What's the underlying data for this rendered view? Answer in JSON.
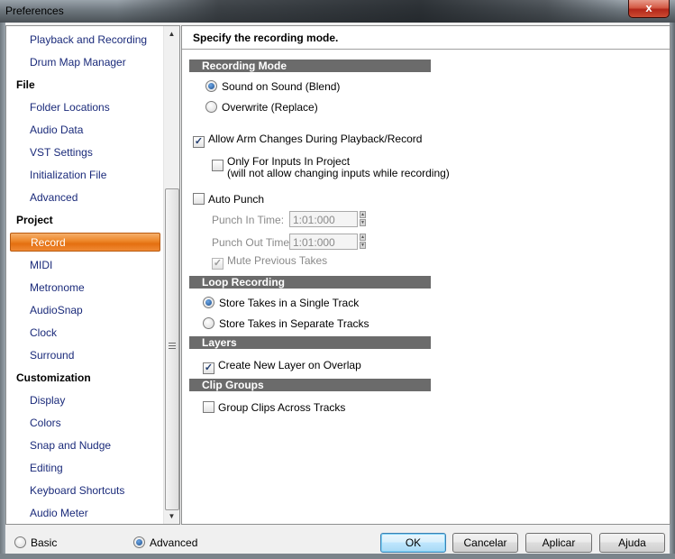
{
  "window": {
    "title": "Preferences",
    "close_label": "x"
  },
  "sidebar": {
    "items": [
      {
        "label": "Playback and Recording",
        "type": "item"
      },
      {
        "label": "Drum Map Manager",
        "type": "item"
      },
      {
        "label": "File",
        "type": "category"
      },
      {
        "label": "Folder Locations",
        "type": "item"
      },
      {
        "label": "Audio Data",
        "type": "item"
      },
      {
        "label": "VST Settings",
        "type": "item"
      },
      {
        "label": "Initialization File",
        "type": "item"
      },
      {
        "label": "Advanced",
        "type": "item"
      },
      {
        "label": "Project",
        "type": "category"
      },
      {
        "label": "Record",
        "type": "item",
        "selected": true
      },
      {
        "label": "MIDI",
        "type": "item"
      },
      {
        "label": "Metronome",
        "type": "item"
      },
      {
        "label": "AudioSnap",
        "type": "item"
      },
      {
        "label": "Clock",
        "type": "item"
      },
      {
        "label": "Surround",
        "type": "item"
      },
      {
        "label": "Customization",
        "type": "category"
      },
      {
        "label": "Display",
        "type": "item"
      },
      {
        "label": "Colors",
        "type": "item"
      },
      {
        "label": "Snap and Nudge",
        "type": "item"
      },
      {
        "label": "Editing",
        "type": "item"
      },
      {
        "label": "Keyboard Shortcuts",
        "type": "item"
      },
      {
        "label": "Audio Meter",
        "type": "item"
      }
    ],
    "scroll_up_icon": "triangle-up",
    "scroll_down_icon": "triangle-down"
  },
  "main": {
    "header": "Specify the recording mode.",
    "sections": {
      "recording_mode": "Recording Mode",
      "loop_recording": "Loop Recording",
      "layers": "Layers",
      "clip_groups": "Clip Groups"
    },
    "recording_mode": {
      "sound_on_sound": {
        "label": "Sound on Sound (Blend)",
        "checked": true
      },
      "overwrite": {
        "label": "Overwrite (Replace)",
        "checked": false
      }
    },
    "allow_arm_changes": {
      "label": "Allow Arm Changes During Playback/Record",
      "checked": true
    },
    "only_for_inputs": {
      "label_line1": "Only For Inputs In Project",
      "label_line2": "(will not allow changing inputs while recording)",
      "checked": false
    },
    "auto_punch": {
      "label": "Auto Punch",
      "checked": false
    },
    "punch_in": {
      "label": "Punch In Time:",
      "value": "1:01:000"
    },
    "punch_out": {
      "label": "Punch Out Time:",
      "value": "1:01:000"
    },
    "mute_previous_takes": {
      "label": "Mute Previous Takes",
      "checked": true,
      "disabled": true
    },
    "loop_recording": {
      "single_track": {
        "label": "Store Takes in a Single Track",
        "checked": true
      },
      "separate_tracks": {
        "label": "Store Takes in Separate Tracks",
        "checked": false
      }
    },
    "layers": {
      "create_new_layer": {
        "label": "Create New Layer on Overlap",
        "checked": true
      }
    },
    "clip_groups": {
      "group_clips": {
        "label": "Group Clips Across Tracks",
        "checked": false
      }
    }
  },
  "footer": {
    "mode_basic": {
      "label": "Basic",
      "checked": false
    },
    "mode_advanced": {
      "label": "Advanced",
      "checked": true
    },
    "ok": "OK",
    "cancel": "Cancelar",
    "apply": "Aplicar",
    "help": "Ajuda"
  },
  "colors": {
    "selection_orange": "#ee8a2e",
    "section_header_gray": "#6b6b6b",
    "link_blue": "#1a2a7a"
  },
  "check_glyph": "✓"
}
